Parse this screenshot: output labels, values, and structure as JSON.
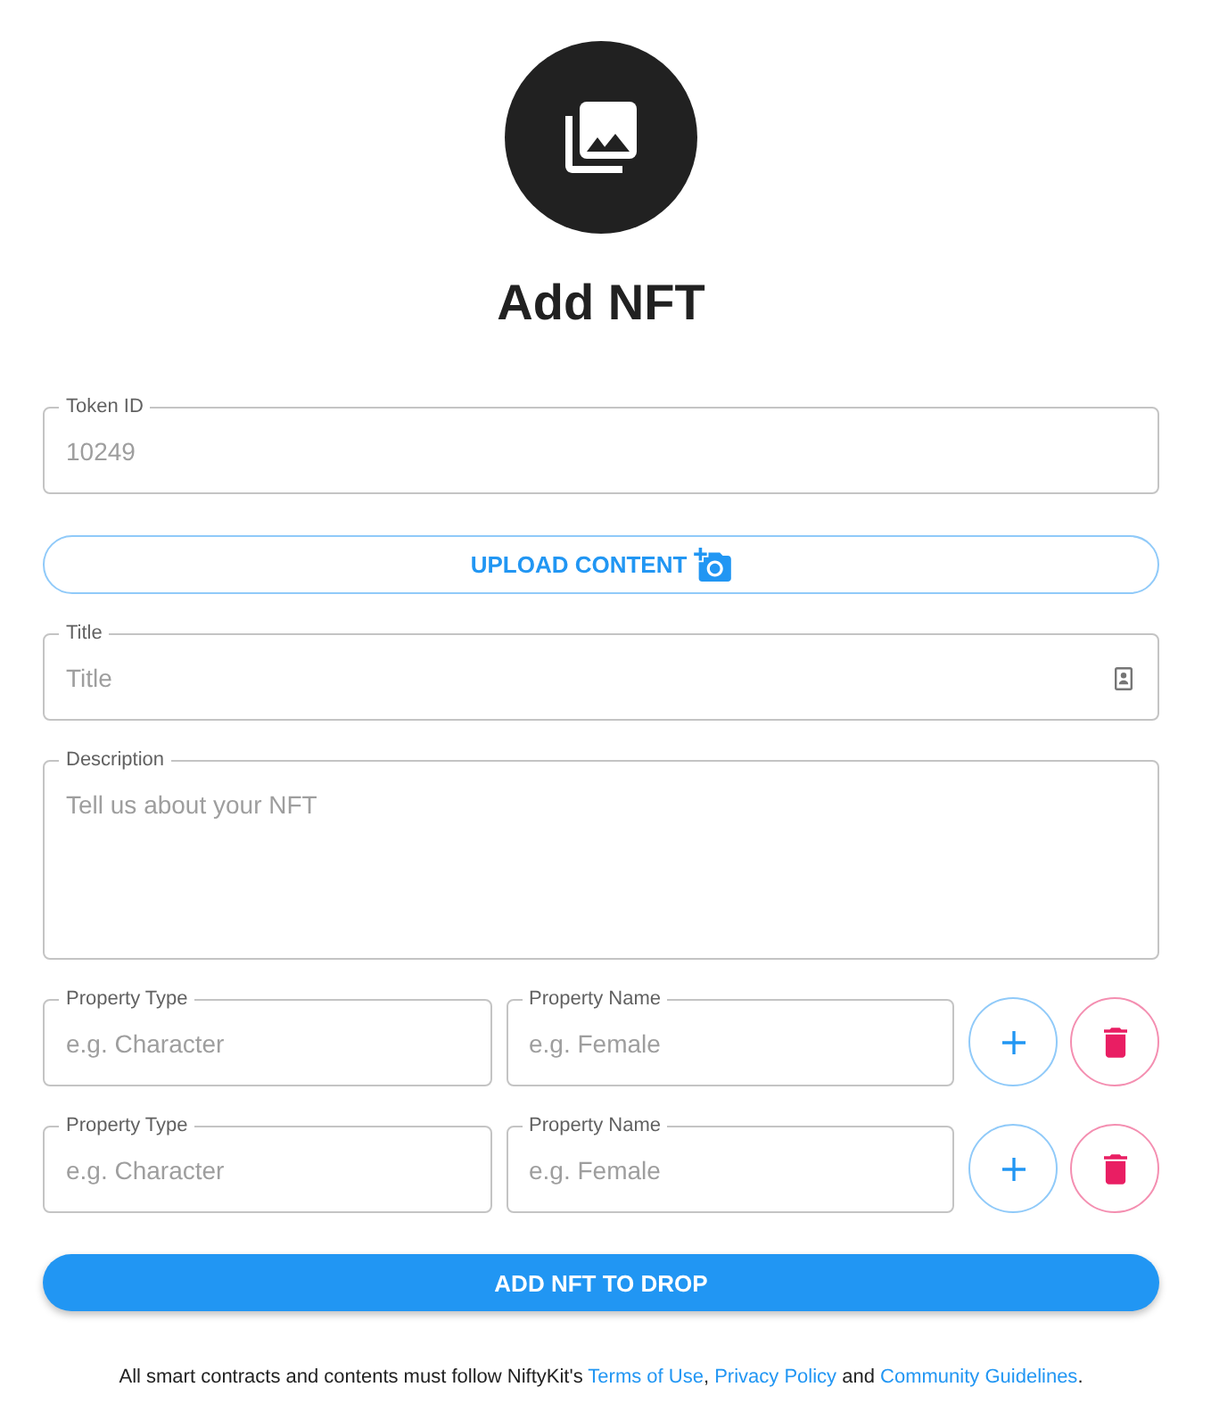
{
  "heading": "Add NFT",
  "token_field": {
    "label": "Token ID",
    "value": "10249",
    "disabled": true
  },
  "upload_button": {
    "label": "UPLOAD CONTENT"
  },
  "title_field": {
    "label": "Title",
    "placeholder": "Title"
  },
  "description_field": {
    "label": "Description",
    "placeholder": "Tell us about your NFT"
  },
  "properties": [
    {
      "type_field": {
        "label": "Property Type",
        "placeholder": "e.g. Character"
      },
      "name_field": {
        "label": "Property Name",
        "placeholder": "e.g. Female"
      }
    },
    {
      "type_field": {
        "label": "Property Type",
        "placeholder": "e.g. Character"
      },
      "name_field": {
        "label": "Property Name",
        "placeholder": "e.g. Female"
      }
    }
  ],
  "submit_button": {
    "label": "ADD NFT TO DROP"
  },
  "footer": {
    "parts": [
      {
        "kind": "text",
        "text": "All smart contracts and contents must follow NiftyKit's "
      },
      {
        "kind": "link",
        "text": "Terms of Use"
      },
      {
        "kind": "text",
        "text": ", "
      },
      {
        "kind": "link",
        "text": "Privacy Policy"
      },
      {
        "kind": "text",
        "text": " and "
      },
      {
        "kind": "link",
        "text": "Community Guidelines"
      },
      {
        "kind": "text",
        "text": "."
      }
    ]
  }
}
